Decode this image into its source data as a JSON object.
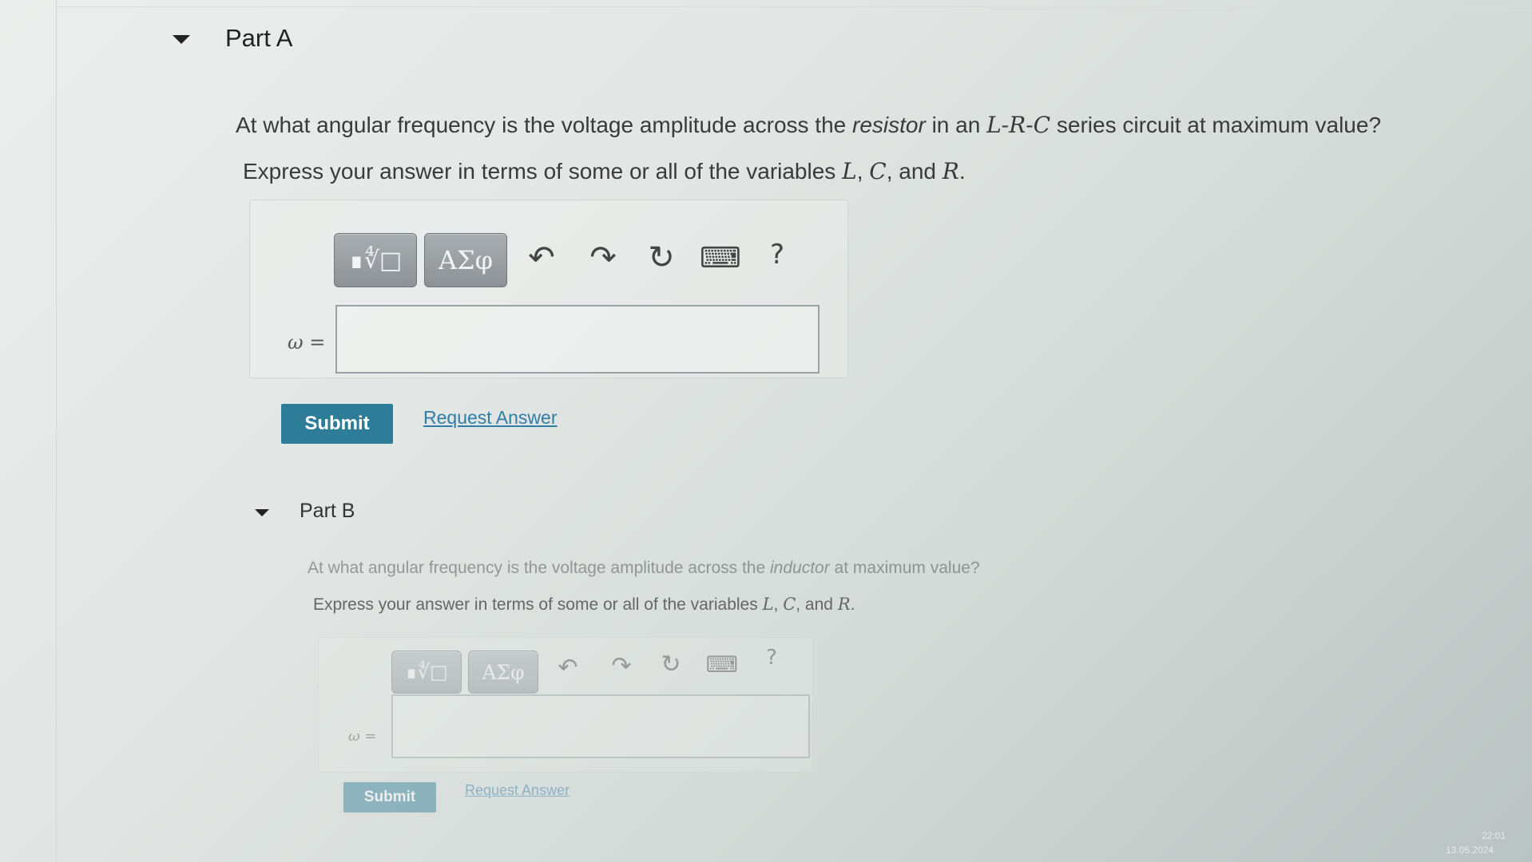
{
  "partA": {
    "title": "Part A",
    "q_pre": "At what angular frequency is the voltage amplitude across the ",
    "q_ital": "resistor",
    "q_mid": " in an ",
    "q_circuit": "L-R-C",
    "q_post": " series circuit at maximum value?",
    "instr_pre": "Express your answer in terms of some or all of the variables ",
    "var_L": "L",
    "sep1": ", ",
    "var_C": "C",
    "sep2": ", and ",
    "var_R": "R",
    "instr_end": ".",
    "templates_label": "∎∜□",
    "greek_label": "ΑΣφ",
    "undo_icon": "↶",
    "redo_icon": "↷",
    "reset_icon": "↻",
    "keyboard_icon": "⌨",
    "help_label": "?",
    "answer_label": "ω =",
    "answer_value": "",
    "submit_label": "Submit",
    "request_label": "Request Answer"
  },
  "partB": {
    "title": "Part B",
    "q_pre": "At what angular frequency is the voltage amplitude across the ",
    "q_ital": "inductor",
    "q_post": " at maximum value?",
    "instr_pre": "Express your answer in terms of some or all of the variables ",
    "var_L": "L",
    "sep1": ", ",
    "var_C": "C",
    "sep2": ", and ",
    "var_R": "R",
    "instr_end": ".",
    "templates_label": "∎∜□",
    "greek_label": "ΑΣφ",
    "undo_icon": "↶",
    "redo_icon": "↷",
    "reset_icon": "↻",
    "keyboard_icon": "⌨",
    "help_label": "?",
    "answer_label": "ω =",
    "answer_value": "",
    "submit_label": "Submit",
    "request_label": "Request Answer"
  },
  "taskbar": {
    "time": "22:01",
    "date": "13.05.2024"
  }
}
